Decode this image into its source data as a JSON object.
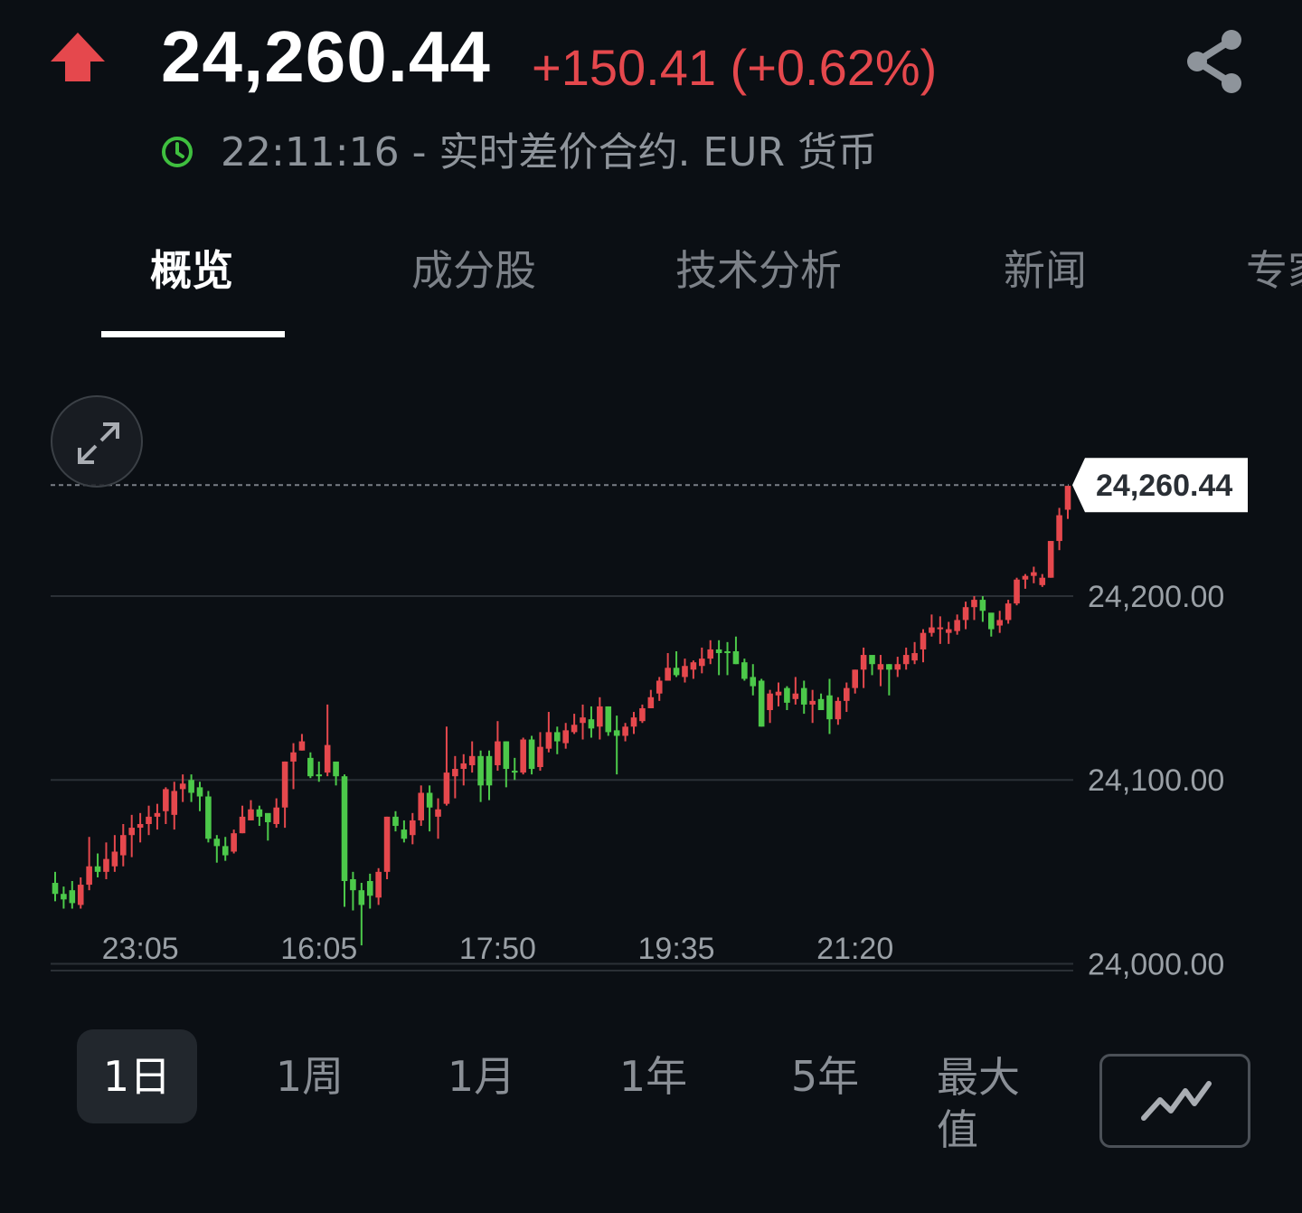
{
  "quote": {
    "price": "24,260.44",
    "change": "+150.41 (+0.62%)",
    "subtitle": "22:11:16 - 实时差价合约.  EUR 货币",
    "direction_icon": "up-arrow-icon",
    "up_color": "#e5484d",
    "down_color": "#4cc94a"
  },
  "tabs": [
    {
      "label": "概览",
      "active": true
    },
    {
      "label": "成分股",
      "active": false
    },
    {
      "label": "技术分析",
      "active": false
    },
    {
      "label": "新闻",
      "active": false
    },
    {
      "label": "专家",
      "active": false
    }
  ],
  "range_buttons": [
    {
      "label": "1日",
      "active": true
    },
    {
      "label": "1周",
      "active": false
    },
    {
      "label": "1月",
      "active": false
    },
    {
      "label": "1年",
      "active": false
    },
    {
      "label": "5年",
      "active": false
    },
    {
      "label": "最大值",
      "active": false
    }
  ],
  "chart_data": {
    "type": "candlestick",
    "last_price_label": "24,260.44",
    "last_price": 24260.44,
    "y_ticks": [
      {
        "value": 24200,
        "label": "24,200.00"
      },
      {
        "value": 24100,
        "label": "24,100.00"
      },
      {
        "value": 24000,
        "label": "24,000.00"
      }
    ],
    "ylim": [
      23983,
      24325
    ],
    "x_ticks": [
      {
        "index": 10,
        "label": "23:05"
      },
      {
        "index": 31,
        "label": "16:05"
      },
      {
        "index": 52,
        "label": "17:50"
      },
      {
        "index": 73,
        "label": "19:35"
      },
      {
        "index": 94,
        "label": "21:20"
      }
    ],
    "grid": true,
    "candles": [
      [
        24044,
        24038,
        24050,
        24034
      ],
      [
        24038,
        24035,
        24042,
        24030
      ],
      [
        24040,
        24033,
        24045,
        24030
      ],
      [
        24032,
        24043,
        24047,
        24030
      ],
      [
        24043,
        24053,
        24069,
        24040
      ],
      [
        24053,
        24050,
        24060,
        24047
      ],
      [
        24050,
        24057,
        24066,
        24046
      ],
      [
        24053,
        24061,
        24070,
        24050
      ],
      [
        24059,
        24070,
        24076,
        24053
      ],
      [
        24070,
        24074,
        24081,
        24058
      ],
      [
        24074,
        24076,
        24082,
        24066
      ],
      [
        24076,
        24080,
        24086,
        24070
      ],
      [
        24080,
        24082,
        24087,
        24073
      ],
      [
        24083,
        24095,
        24096,
        24076
      ],
      [
        24081,
        24094,
        24099,
        24073
      ],
      [
        24095,
        24098,
        24103,
        24088
      ],
      [
        24100,
        24093,
        24103,
        24088
      ],
      [
        24096,
        24091,
        24099,
        24083
      ],
      [
        24091,
        24068,
        24094,
        24066
      ],
      [
        24068,
        24064,
        24070,
        24055
      ],
      [
        24064,
        24059,
        24069,
        24056
      ],
      [
        24061,
        24071,
        24073,
        24060
      ],
      [
        24071,
        24080,
        24086,
        24071
      ],
      [
        24078,
        24084,
        24089,
        24078
      ],
      [
        24084,
        24080,
        24086,
        24075
      ],
      [
        24082,
        24077,
        24081,
        24067
      ],
      [
        24076,
        24085,
        24090,
        24074
      ],
      [
        24085,
        24110,
        24110,
        24074
      ],
      [
        24110,
        24115,
        24120,
        24095
      ],
      [
        24116,
        24121,
        24125,
        24116
      ],
      [
        24112,
        24102,
        24115,
        24101
      ],
      [
        24103,
        24102,
        24110,
        24099
      ],
      [
        24104,
        24119,
        24141,
        24102
      ],
      [
        24110,
        24102,
        24107,
        24097
      ],
      [
        24102,
        24045,
        24103,
        24031
      ],
      [
        24046,
        24040,
        24050,
        24029
      ],
      [
        24040,
        24032,
        24044,
        24010
      ],
      [
        24045,
        24037,
        24049,
        24030
      ],
      [
        24036,
        24050,
        24052,
        24032
      ],
      [
        24050,
        24080,
        24080,
        24046
      ],
      [
        24080,
        24075,
        24083,
        24072
      ],
      [
        24073,
        24068,
        24078,
        24066
      ],
      [
        24070,
        24078,
        24082,
        24065
      ],
      [
        24078,
        24093,
        24097,
        24075
      ],
      [
        24093,
        24085,
        24097,
        24072
      ],
      [
        24080,
        24084,
        24090,
        24068
      ],
      [
        24087,
        24104,
        24129,
        24086
      ],
      [
        24102,
        24106,
        24113,
        24090
      ],
      [
        24106,
        24109,
        24114,
        24097
      ],
      [
        24108,
        24113,
        24121,
        24104
      ],
      [
        24113,
        24097,
        24116,
        24088
      ],
      [
        24113,
        24097,
        24116,
        24089
      ],
      [
        24108,
        24121,
        24132,
        24105
      ],
      [
        24121,
        24106,
        24121,
        24096
      ],
      [
        24105,
        24104,
        24112,
        24100
      ],
      [
        24104,
        24122,
        24123,
        24103
      ],
      [
        24122,
        24106,
        24124,
        24103
      ],
      [
        24107,
        24118,
        24126,
        24105
      ],
      [
        24117,
        24126,
        24137,
        24115
      ],
      [
        24126,
        24121,
        24129,
        24114
      ],
      [
        24120,
        24127,
        24131,
        24117
      ],
      [
        24126,
        24130,
        24136,
        24125
      ],
      [
        24131,
        24134,
        24141,
        24122
      ],
      [
        24133,
        24128,
        24140,
        24123
      ],
      [
        24129,
        24140,
        24145,
        24122
      ],
      [
        24140,
        24126,
        24140,
        24124
      ],
      [
        24127,
        24124,
        24135,
        24103
      ],
      [
        24124,
        24129,
        24131,
        24121
      ],
      [
        24129,
        24134,
        24137,
        24125
      ],
      [
        24132,
        24139,
        24141,
        24131
      ],
      [
        24139,
        24145,
        24149,
        24139
      ],
      [
        24147,
        24154,
        24156,
        24143
      ],
      [
        24154,
        24161,
        24169,
        24155
      ],
      [
        24161,
        24157,
        24170,
        24156
      ],
      [
        24156,
        24162,
        24166,
        24153
      ],
      [
        24160,
        24164,
        24165,
        24155
      ],
      [
        24162,
        24166,
        24172,
        24158
      ],
      [
        24166,
        24171,
        24176,
        24163
      ],
      [
        24171,
        24169,
        24176,
        24157
      ],
      [
        24170,
        24169,
        24175,
        24157
      ],
      [
        24170,
        24163,
        24178,
        24163
      ],
      [
        24164,
        24155,
        24166,
        24154
      ],
      [
        24156,
        24151,
        24163,
        24146
      ],
      [
        24154,
        24129,
        24155,
        24129
      ],
      [
        24138,
        24147,
        24149,
        24131
      ],
      [
        24146,
        24148,
        24153,
        24140
      ],
      [
        24150,
        24142,
        24151,
        24138
      ],
      [
        24144,
        24147,
        24156,
        24141
      ],
      [
        24150,
        24141,
        24154,
        24136
      ],
      [
        24141,
        24143,
        24149,
        24131
      ],
      [
        24144,
        24138,
        24147,
        24139
      ],
      [
        24146,
        24133,
        24155,
        24125
      ],
      [
        24133,
        24143,
        24145,
        24130
      ],
      [
        24143,
        24150,
        24153,
        24137
      ],
      [
        24150,
        24160,
        24160,
        24147
      ],
      [
        24160,
        24168,
        24172,
        24150
      ],
      [
        24168,
        24163,
        24167,
        24157
      ],
      [
        24160,
        24163,
        24168,
        24151
      ],
      [
        24163,
        24160,
        24163,
        24146
      ],
      [
        24160,
        24163,
        24167,
        24156
      ],
      [
        24163,
        24168,
        24172,
        24160
      ],
      [
        24165,
        24169,
        24175,
        24163
      ],
      [
        24171,
        24180,
        24182,
        24164
      ],
      [
        24180,
        24183,
        24190,
        24178
      ],
      [
        24182,
        24183,
        24189,
        24174
      ],
      [
        24180,
        24182,
        24186,
        24174
      ],
      [
        24181,
        24187,
        24190,
        24179
      ],
      [
        24187,
        24194,
        24197,
        24182
      ],
      [
        24194,
        24198,
        24200,
        24187
      ],
      [
        24198,
        24192,
        24200,
        24186
      ],
      [
        24191,
        24182,
        24190,
        24178
      ],
      [
        24184,
        24187,
        24192,
        24180
      ],
      [
        24187,
        24196,
        24198,
        24185
      ],
      [
        24196,
        24209,
        24210,
        24195
      ],
      [
        24209,
        24211,
        24212,
        24204
      ],
      [
        24211,
        24213,
        24216,
        24207
      ],
      [
        24206,
        24210,
        24212,
        24205
      ],
      [
        24210,
        24230,
        24230,
        24210
      ],
      [
        24230,
        24244,
        24248,
        24225
      ],
      [
        24247,
        24260,
        24260,
        24242
      ]
    ]
  }
}
